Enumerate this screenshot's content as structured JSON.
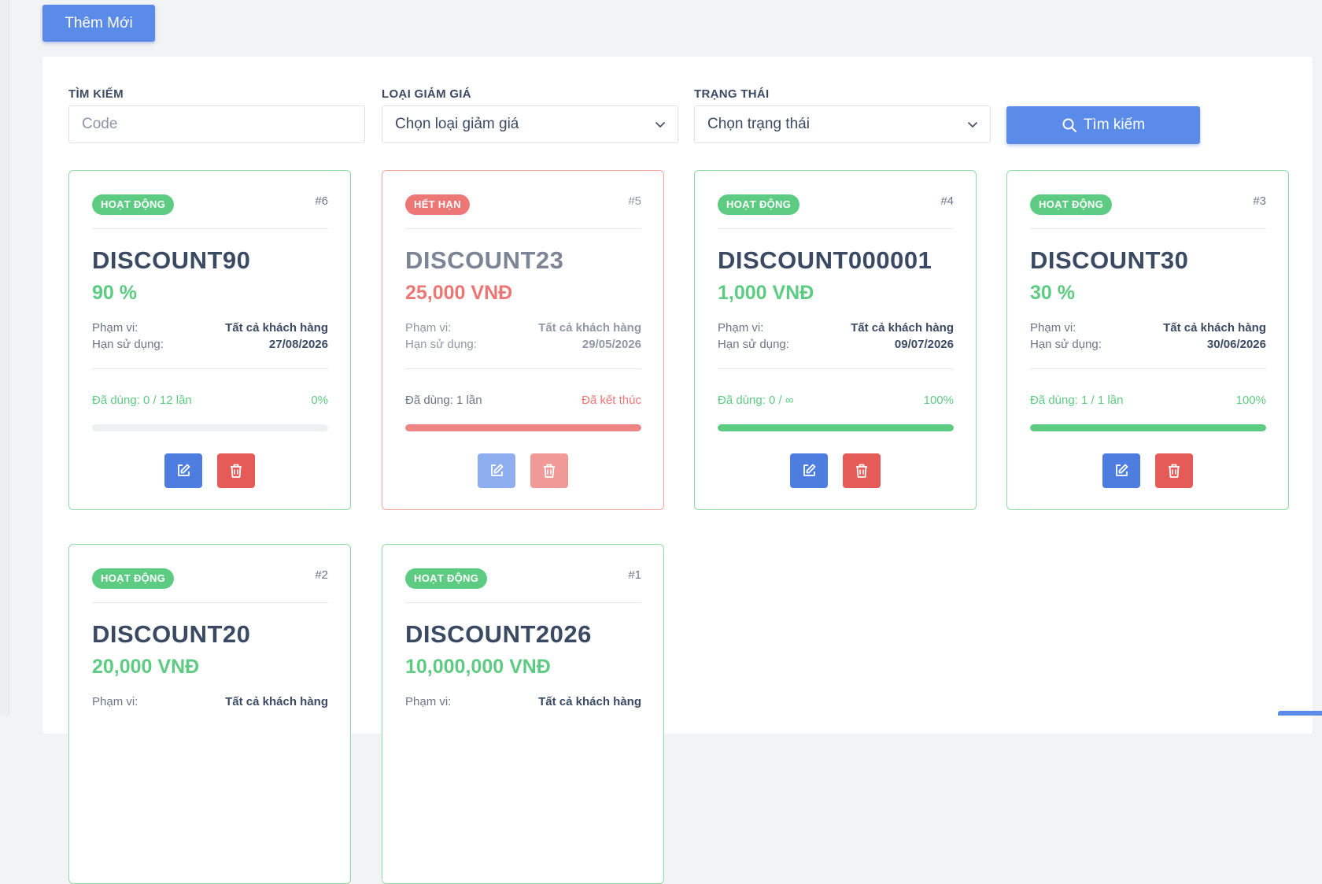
{
  "toolbar": {
    "add_label": "Thêm Mới"
  },
  "filters": {
    "search_label": "TÌM KIẾM",
    "search_placeholder": "Code",
    "type_label": "LOẠI GIẢM GIÁ",
    "type_value": "Chọn loại giảm giá",
    "status_label": "TRẠNG THÁI",
    "status_value": "Chọn trạng thái",
    "search_button": "Tìm kiếm"
  },
  "colors": {
    "primary": "#5b8be8",
    "success": "#5ecb82",
    "danger": "#e55b58",
    "text": "#3b4a63"
  },
  "icons": {
    "search": "search-icon",
    "chevron": "chevron-down-icon",
    "edit": "edit-icon",
    "delete": "trash-icon"
  },
  "cards": [
    {
      "badge": "HOẠT ĐỘNG",
      "id": "#6",
      "code": "DISCOUNT90",
      "value": "90 %",
      "scope_label": "Phạm vi:",
      "scope": "Tất cả khách hàng",
      "expiry_label": "Hạn sử dụng:",
      "expiry": "27/08/2026",
      "usage": "Đã dùng: 0 / 12 lần",
      "percent": "0%",
      "progress": 0
    },
    {
      "badge": "HẾT HẠN",
      "id": "#5",
      "code": "DISCOUNT23",
      "value": "25,000 VNĐ",
      "scope_label": "Phạm vi:",
      "scope": "Tất cả khách hàng",
      "expiry_label": "Hạn sử dụng:",
      "expiry": "29/05/2026",
      "usage": "Đã dùng: 1 lần",
      "percent": "Đã kết thúc",
      "progress": 100
    },
    {
      "badge": "HOẠT ĐỘNG",
      "id": "#4",
      "code": "DISCOUNT000001",
      "value": "1,000 VNĐ",
      "scope_label": "Phạm vi:",
      "scope": "Tất cả khách hàng",
      "expiry_label": "Hạn sử dụng:",
      "expiry": "09/07/2026",
      "usage": "Đã dùng: 0 / ∞",
      "percent": "100%",
      "progress": 100
    },
    {
      "badge": "HOẠT ĐỘNG",
      "id": "#3",
      "code": "DISCOUNT30",
      "value": "30 %",
      "scope_label": "Phạm vi:",
      "scope": "Tất cả khách hàng",
      "expiry_label": "Hạn sử dụng:",
      "expiry": "30/06/2026",
      "usage": "Đã dùng: 1 / 1 lần",
      "percent": "100%",
      "progress": 100
    },
    {
      "badge": "HOẠT ĐỘNG",
      "id": "#2",
      "code": "DISCOUNT20",
      "value": "20,000 VNĐ",
      "scope_label": "Phạm vi:",
      "scope": "Tất cả khách hàng"
    },
    {
      "badge": "HOẠT ĐỘNG",
      "id": "#1",
      "code": "DISCOUNT2026",
      "value": "10,000,000 VNĐ",
      "scope_label": "Phạm vi:",
      "scope": "Tất cả khách hàng"
    }
  ]
}
